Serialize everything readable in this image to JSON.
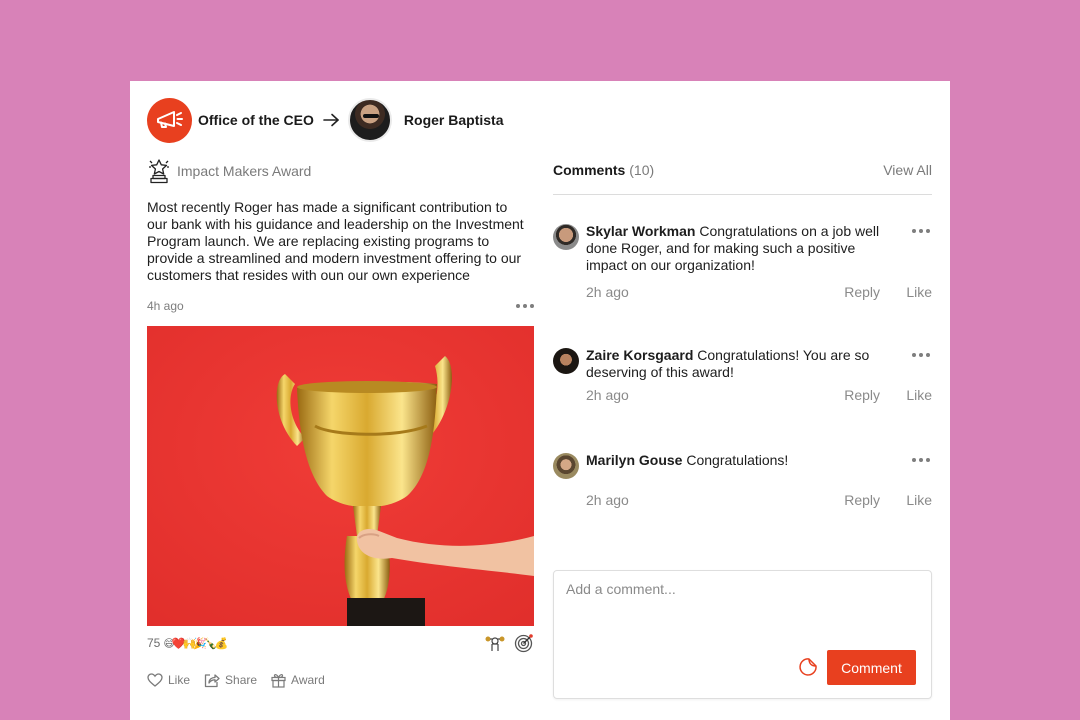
{
  "colors": {
    "background": "#d882b8",
    "accent": "#e8401f",
    "image_bg": "#ee3a35"
  },
  "header": {
    "sender_icon": "megaphone-icon",
    "sender_name": "Office of the CEO",
    "arrow_icon": "arrow-right-icon",
    "recipient_name": "Roger Baptista"
  },
  "post": {
    "award_icon": "trophy-star-icon",
    "award_name": "Impact Makers Award",
    "body": "Most recently Roger has made a significant contribution to our bank with his guidance and leadership on the Investment Program launch. We are replacing existing programs to provide a streamlined and modern investment offering to our customers that resides with oun our own experience",
    "time": "4h ago",
    "more_icon": "more-dots-icon",
    "image_alt": "Hand holding a gold trophy cup against a red background",
    "reaction_count": "75",
    "reaction_emojis": "😄❤️🙌🎉🍾💰",
    "badge_icons": [
      "strong-arm-badge-icon",
      "target-badge-icon"
    ],
    "actions": [
      {
        "label": "Like",
        "icon": "heart-icon"
      },
      {
        "label": "Share",
        "icon": "share-icon"
      },
      {
        "label": "Award",
        "icon": "gift-icon"
      }
    ]
  },
  "comments": {
    "title": "Comments",
    "count": "(10)",
    "view_all": "View All",
    "items": [
      {
        "author": "Skylar Workman",
        "text": "Congratulations on a job well done Roger, and for making such a positive impact on our organization!",
        "time": "2h ago",
        "reply": "Reply",
        "like": "Like"
      },
      {
        "author": "Zaire Korsgaard",
        "text": "Congratulations! You are so deserving of this award!",
        "time": "2h ago",
        "reply": "Reply",
        "like": "Like"
      },
      {
        "author": "Marilyn Gouse",
        "text": "Congratulations!",
        "time": "2h ago",
        "reply": "Reply",
        "like": "Like"
      }
    ],
    "input_placeholder": "Add a comment...",
    "input_value": "",
    "sticker_icon": "sticker-icon",
    "submit_label": "Comment"
  }
}
